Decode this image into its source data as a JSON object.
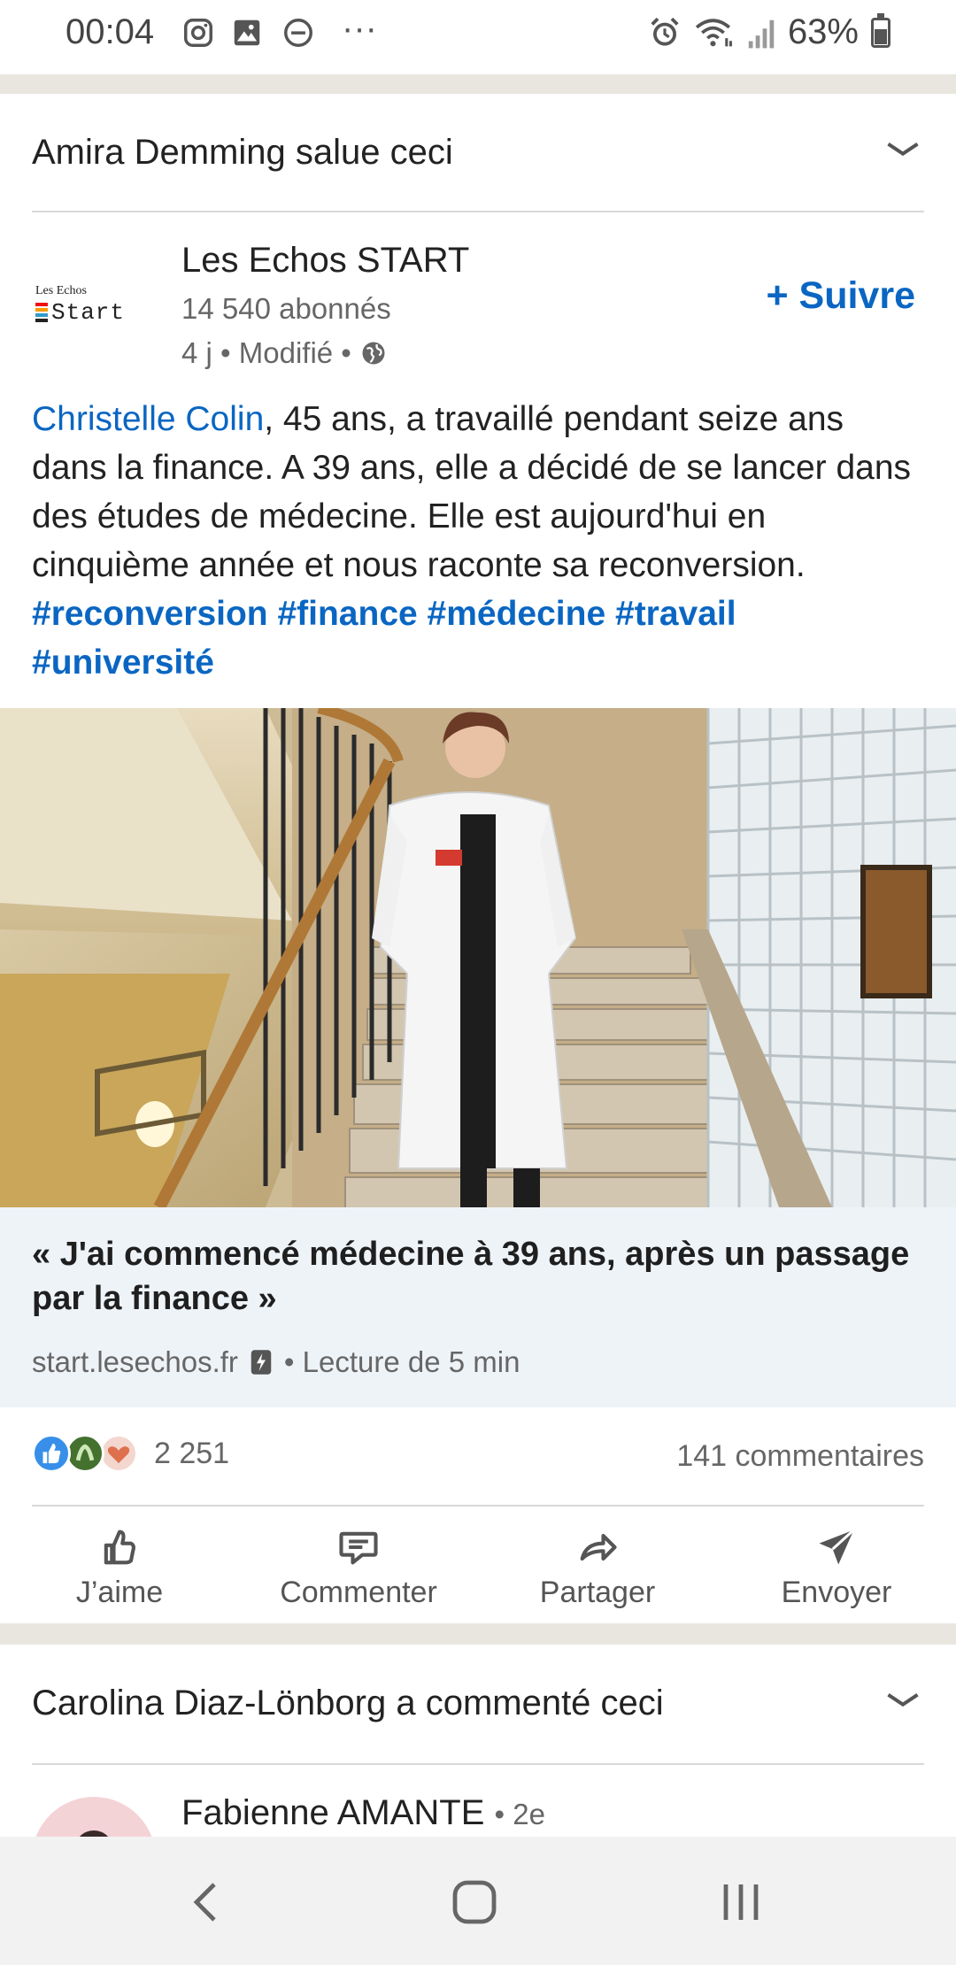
{
  "status_bar": {
    "time": "00:04",
    "battery": "63%",
    "overflow_glyph": "···",
    "icons": [
      "instagram-icon",
      "gallery-icon",
      "do-not-disturb-icon",
      "alarm-icon",
      "wifi-icon",
      "signal-icon",
      "battery-icon"
    ]
  },
  "post1": {
    "social": {
      "actor": "Amira Demming",
      "action": " salue ceci"
    },
    "author": {
      "name": "Les Echos START",
      "followers": "14 540 abonnés",
      "meta": "4 j • Modifié •",
      "logo_text_top": "Les Echos",
      "logo_text_main": "Start",
      "follow_label": "+ Suivre"
    },
    "text": {
      "mention": "Christelle Colin",
      "body": ", 45 ans, a travaillé pendant seize ans dans la finance. A 39 ans, elle a décidé de se lancer dans des études de médecine. Elle est aujourd'hui en cinquième année et nous raconte sa reconversion.",
      "hashtags": [
        "#reconversion",
        "#finance",
        "#médecine",
        "#travail",
        "#université"
      ]
    },
    "article": {
      "title": "« J'ai commencé médecine à 39 ans, après un passage par la finance »",
      "source": "start.lesechos.fr",
      "read_time": "• Lecture de 5 min"
    },
    "stats": {
      "reactions": "2 251",
      "comments": "141 commentaires"
    },
    "actions": [
      {
        "label": "J’aime",
        "icon": "like-icon"
      },
      {
        "label": "Commenter",
        "icon": "comment-icon"
      },
      {
        "label": "Partager",
        "icon": "share-icon"
      },
      {
        "label": "Envoyer",
        "icon": "send-icon"
      }
    ]
  },
  "post2": {
    "social": {
      "actor": "Carolina Diaz-Lönborg",
      "action": " a commenté ceci"
    },
    "commenter": {
      "name": "Fabienne AMANTE",
      "degree": "• 2e"
    }
  },
  "nav_bar": {
    "buttons": [
      "back-button",
      "home-button",
      "recents-button"
    ]
  },
  "colors": {
    "linkedin_blue": "#0a66c2",
    "background": "#e9e6df",
    "article_bg": "#eef3f8"
  }
}
